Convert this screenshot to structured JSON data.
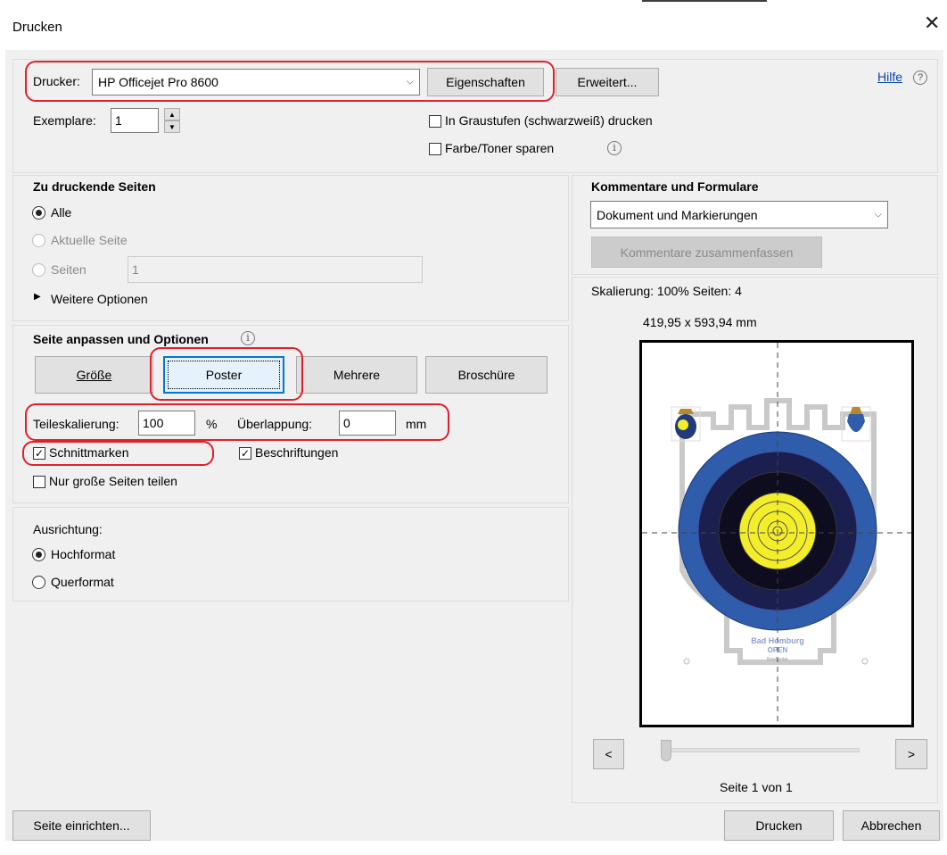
{
  "window": {
    "title": "Drucken",
    "close_glyph": "✕"
  },
  "printer": {
    "label": "Drucker:",
    "selected": "HP Officejet Pro 8600",
    "properties_button": "Eigenschaften",
    "advanced_button": "Erweitert...",
    "help_link": "Hilfe",
    "help_icon": "?",
    "copies_label": "Exemplare:",
    "copies_value": "1",
    "grayscale_label": "In Graustufen (schwarzweiß) drucken",
    "grayscale_checked": false,
    "save_toner_label": "Farbe/Toner sparen",
    "save_toner_checked": false,
    "info_icon": "i"
  },
  "pages_to_print": {
    "heading": "Zu druckende Seiten",
    "all_label": "Alle",
    "current_label": "Aktuelle Seite",
    "pages_label": "Seiten",
    "pages_value": "1",
    "more_options": "Weitere Optionen",
    "selected": "Alle"
  },
  "page_sizing": {
    "heading": "Seite anpassen und Optionen",
    "info_icon": "i",
    "tabs": [
      "Größe",
      "Poster",
      "Mehrere",
      "Broschüre"
    ],
    "active_tab": "Poster",
    "tile_scale_label": "Teileskalierung:",
    "tile_scale_value": "100",
    "tile_scale_unit": "%",
    "overlap_label": "Überlappung:",
    "overlap_value": "0",
    "overlap_unit": "mm",
    "cut_marks_label": "Schnittmarken",
    "cut_marks_checked": true,
    "labels_label": "Beschriftungen",
    "labels_checked": true,
    "large_pages_label": "Nur große Seiten teilen",
    "large_pages_checked": false
  },
  "orientation": {
    "heading": "Ausrichtung:",
    "portrait_label": "Hochformat",
    "landscape_label": "Querformat",
    "selected": "Hochformat"
  },
  "comments_forms": {
    "heading": "Kommentare und Formulare",
    "selected": "Dokument und Markierungen",
    "summarize_button": "Kommentare zusammenfassen"
  },
  "preview": {
    "scaling_text": "Skalierung: 100% Seiten: 4",
    "size_text": "419,95 x 593,94 mm",
    "prev_button": "<",
    "next_button": ">",
    "page_counter": "Seite 1 von 1",
    "target_caption": "Bad Homburg",
    "target_caption2": "OPEN",
    "target_caption3": "Bowhunter",
    "target_colors": {
      "blue": "#2f5cab",
      "black": "#0d0d1f",
      "navy": "#1b1f4f",
      "yellow": "#f4ee2a"
    }
  },
  "footer": {
    "page_setup_button": "Seite einrichten...",
    "print_button": "Drucken",
    "cancel_button": "Abbrechen"
  },
  "annotation_color": "#e0202a"
}
